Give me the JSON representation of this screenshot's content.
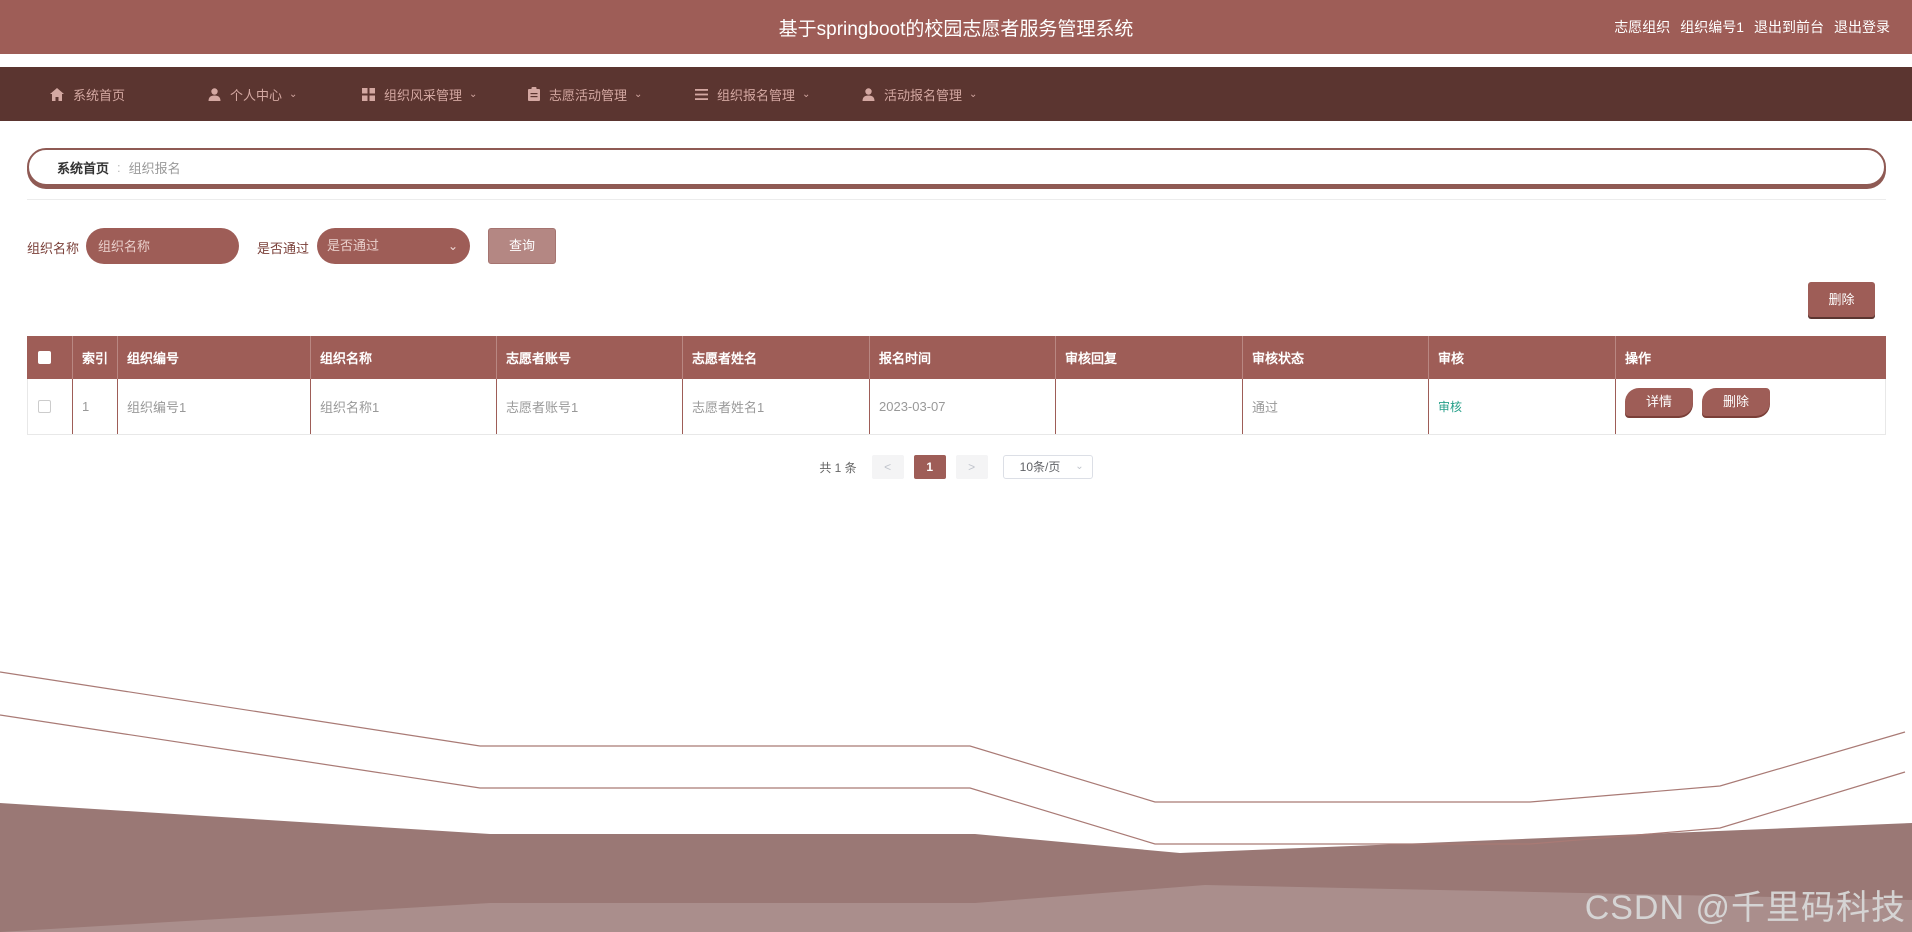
{
  "header": {
    "title": "基于springboot的校园志愿者服务管理系统",
    "role": "志愿组织",
    "user": "组织编号1",
    "back_front": "退出到前台",
    "logout": "退出登录"
  },
  "nav": [
    {
      "label": "系统首页",
      "icon": "home-icon",
      "has_caret": false
    },
    {
      "label": "个人中心",
      "icon": "user-icon",
      "has_caret": true
    },
    {
      "label": "组织风采管理",
      "icon": "grid-icon",
      "has_caret": true
    },
    {
      "label": "志愿活动管理",
      "icon": "clipboard-icon",
      "has_caret": true
    },
    {
      "label": "组织报名管理",
      "icon": "list-icon",
      "has_caret": true
    },
    {
      "label": "活动报名管理",
      "icon": "user-icon",
      "has_caret": true
    }
  ],
  "breadcrumb": {
    "home": "系统首页",
    "separator": ":",
    "current": "组织报名"
  },
  "filters": {
    "org_name_label": "组织名称",
    "org_name_placeholder": "组织名称",
    "passed_label": "是否通过",
    "passed_placeholder": "是否通过",
    "query_label": "查询"
  },
  "toolbar": {
    "delete_label": "删除"
  },
  "table": {
    "columns": [
      "索引",
      "组织编号",
      "组织名称",
      "志愿者账号",
      "志愿者姓名",
      "报名时间",
      "审核回复",
      "审核状态",
      "审核",
      "操作"
    ],
    "rows": [
      {
        "index": "1",
        "org_no": "组织编号1",
        "org_name": "组织名称1",
        "volunteer_account": "志愿者账号1",
        "volunteer_name": "志愿者姓名1",
        "signup_time": "2023-03-07",
        "audit_reply": "",
        "audit_status": "通过",
        "audit_link": "审核",
        "detail_label": "详情",
        "delete_label": "删除"
      }
    ]
  },
  "pagination": {
    "total": "共 1 条",
    "prev": "<",
    "current_page": "1",
    "next": ">",
    "page_size": "10条/页"
  },
  "watermark": "CSDN @千里码科技",
  "colors": {
    "primary": "#9e5d57",
    "nav_bg": "#5b3530",
    "nav_text": "#d4a8a2",
    "link": "#27a08a"
  }
}
